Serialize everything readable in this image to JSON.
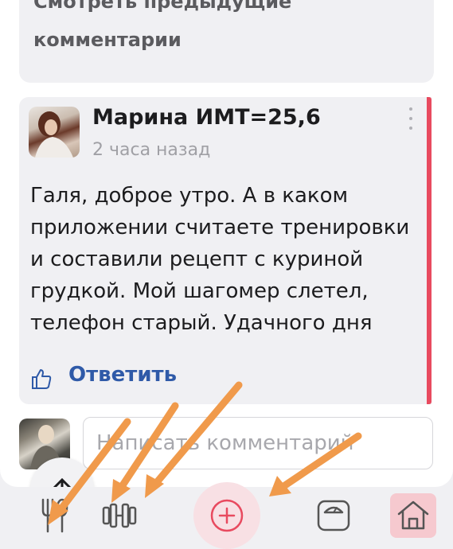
{
  "previous_comments": {
    "line1": "Смотреть предыдущие",
    "line2": "комментарии"
  },
  "comment": {
    "author": "Марина ИМТ=25,6",
    "time": "2 часа назад",
    "text": "Галя, доброе утро. А в каком приложении считаете тренировки и составили рецепт с куриной грудкой. Мой шагомер слетел, телефон старый. Удачного дня",
    "reply_label": "Ответить",
    "accent_color": "#e84a5f"
  },
  "composer": {
    "placeholder": "Написать комментарий"
  },
  "nav": {
    "items": [
      {
        "icon": "fork-spoon-icon"
      },
      {
        "icon": "dumbbell-icon"
      },
      {
        "icon": "add-circle-icon"
      },
      {
        "icon": "scale-icon"
      },
      {
        "icon": "home-icon"
      }
    ],
    "active_color": "#e84a5f"
  },
  "annotations": {
    "arrow_color": "#f09a4b"
  }
}
